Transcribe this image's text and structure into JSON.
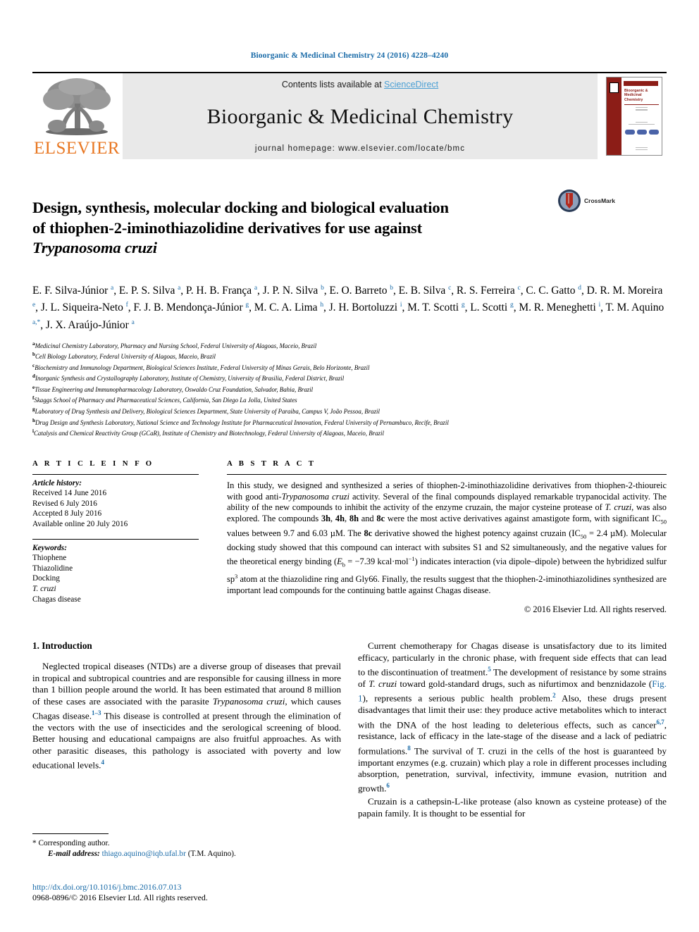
{
  "running_head": "Bioorganic & Medicinal Chemistry 24 (2016) 4228–4240",
  "masthead": {
    "contents_prefix": "Contents lists available at ",
    "sciencedirect": "ScienceDirect",
    "journal_title": "Bioorganic & Medicinal Chemistry",
    "homepage": "journal homepage: www.elsevier.com/locate/bmc",
    "publisher": "ELSEVIER",
    "cover_title": "Bioorganic & Medicinal Chemistry"
  },
  "article": {
    "title_line1": "Design, synthesis, molecular docking and biological evaluation",
    "title_line2": "of thiophen-2-iminothiazolidine derivatives for use against",
    "title_line3_italic": "Trypanosoma cruzi",
    "crossmark_label": "CrossMark"
  },
  "authors_html": "E. F. Silva-Júnior <sup>a</sup>, E. P. S. Silva <sup>a</sup>, P. H. B. França <sup>a</sup>, J. P. N. Silva <sup>b</sup>, E. O. Barreto <sup>b</sup>, E. B. Silva <sup>c</sup>, R. S. Ferreira <sup>c</sup>, C. C. Gatto <sup>d</sup>, D. R. M. Moreira <sup>e</sup>, J. L. Siqueira-Neto <sup>f</sup>, F. J. B. Mendonça-Júnior <sup>g</sup>, M. C. A. Lima <sup>h</sup>, J. H. Bortoluzzi <sup>i</sup>, M. T. Scotti <sup>g</sup>, L. Scotti <sup>g</sup>, M. R. Meneghetti <sup>i</sup>, T. M. Aquino <sup>a,<span class=\"star\">*</span></sup>, J. X. Araújo-Júnior <sup>a</sup>",
  "affiliations": [
    {
      "mark": "a",
      "text": "Medicinal Chemistry Laboratory, Pharmacy and Nursing School, Federal University of Alagoas, Maceio, Brazil"
    },
    {
      "mark": "b",
      "text": "Cell Biology Laboratory, Federal University of Alagoas, Maceio, Brazil"
    },
    {
      "mark": "c",
      "text": "Biochemistry and Immunology Department, Biological Sciences Institute, Federal University of Minas Gerais, Belo Horizonte, Brazil"
    },
    {
      "mark": "d",
      "text": "Inorganic Synthesis and Crystallography Laboratory, Institute of Chemistry, University of Brasilia, Federal District, Brazil"
    },
    {
      "mark": "e",
      "text": "Tissue Engineering and Immunopharmacology Laboratory, Oswaldo Cruz Foundation, Salvador, Bahia, Brazil"
    },
    {
      "mark": "f",
      "text": "Skaggs School of Pharmacy and Pharmaceutical Sciences, California, San Diego La Jolla, United States"
    },
    {
      "mark": "g",
      "text": "Laboratory of Drug Synthesis and Delivery, Biological Sciences Department, State University of Paraiba, Campus V, João Pessoa, Brazil"
    },
    {
      "mark": "h",
      "text": "Drug Design and Synthesis Laboratory, National Science and Technology Institute for Pharmaceutical Innovation, Federal University of Pernambuco, Recife, Brazil"
    },
    {
      "mark": "i",
      "text": "Catalysis and Chemical Reactivity Group (GCaR), Institute of Chemistry and Biotechnology, Federal University of Alagoas, Maceio, Brazil"
    }
  ],
  "article_info": {
    "heading": "A R T I C L E   I N F O",
    "history_label": "Article history:",
    "history": [
      "Received 14 June 2016",
      "Revised 6 July 2016",
      "Accepted 8 July 2016",
      "Available online 20 July 2016"
    ],
    "keywords_label": "Keywords:",
    "keywords": [
      "Thiophene",
      "Thiazolidine",
      "Docking",
      "T. cruzi",
      "Chagas disease"
    ]
  },
  "abstract": {
    "heading": "A B S T R A C T",
    "body_html": "In this study, we designed and synthesized a series of thiophen-2-iminothiazolidine derivatives from thiophen-2-thioureic with good anti-<em>Trypanosoma cruzi</em> activity. Several of the final compounds displayed remarkable trypanocidal activity. The ability of the new compounds to inhibit the activity of the enzyme cruzain, the major cysteine protease of <em>T. cruzi</em>, was also explored. The compounds <b>3h</b>, <b>4h</b>, <b>8h</b> and <b>8c</b> were the most active derivatives against amastigote form, with significant IC<sub>50</sub> values between 9.7 and 6.03 µM. The <b>8c</b> derivative showed the highest potency against cruzain (IC<sub>50</sub> = 2.4 µM). Molecular docking study showed that this compound can interact with subsites S1 and S2 simultaneously, and the negative values for the theoretical energy binding (<em>E</em><sub>b</sub> = −7.39 kcal·mol<sup>−1</sup>) indicates interaction (via dipole–dipole) between the hybridized sulfur sp<sup>3</sup> atom at the thiazolidine ring and Gly66. Finally, the results suggest that the thiophen-2-iminothiazolidines synthesized are important lead compounds for the continuing battle against Chagas disease.",
    "copyright": "© 2016 Elsevier Ltd. All rights reserved."
  },
  "introduction": {
    "heading": "1. Introduction",
    "left_paragraphs_html": [
      "Neglected tropical diseases (NTDs) are a diverse group of diseases that prevail in tropical and subtropical countries and are responsible for causing illness in more than 1 billion people around the world. It has been estimated that around 8 million of these cases are associated with the parasite <em>Trypanosoma cruzi</em>, which causes Chagas disease.<sup>1–3</sup> This disease is controlled at present through the elimination of the vectors with the use of insecticides and the serological screening of blood. Better housing and educational campaigns are also fruitful approaches. As with other parasitic diseases, this pathology is associated with poverty and low educational levels.<sup>4</sup>"
    ],
    "right_paragraphs_html": [
      "Current chemotherapy for Chagas disease is unsatisfactory due to its limited efficacy, particularly in the chronic phase, with frequent side effects that can lead to the discontinuation of treatment.<sup>5</sup> The development of resistance by some strains of <em>T. cruzi</em> toward gold-standard drugs, such as nifurtimox and benznidazole (<a class=\"ref\" href=\"#\">Fig. 1</a>), represents a serious public health problem.<sup>2</sup> Also, these drugs present disadvantages that limit their use: they produce active metabolites which to interact with the DNA of the host leading to deleterious effects, such as cancer<sup>6,7</sup>, resistance, lack of efficacy in the late-stage of the disease and a lack of pediatric formulations.<sup>8</sup> The survival of T. cruzi in the cells of the host is guaranteed by important enzymes (e.g. cruzain) which play a role in different processes including absorption, penetration, survival, infectivity, immune evasion, nutrition and growth.<sup>6</sup>",
      "Cruzain is a cathepsin-L-like protease (also known as cysteine protease) of the papain family. It is thought to be essential for"
    ]
  },
  "footnote": {
    "corresponding": "Corresponding author.",
    "email_label": "E-mail address:",
    "email": "thiago.aquino@iqb.ufal.br",
    "email_owner": "(T.M. Aquino)."
  },
  "footer": {
    "doi": "http://dx.doi.org/10.1016/j.bmc.2016.07.013",
    "issn_line": "0968-0896/© 2016 Elsevier Ltd. All rights reserved."
  },
  "colors": {
    "link_blue": "#1a6ba8",
    "sciencedirect_blue": "#4a9fd4",
    "elsevier_orange": "#E87722",
    "cover_red": "#8c1d17"
  }
}
